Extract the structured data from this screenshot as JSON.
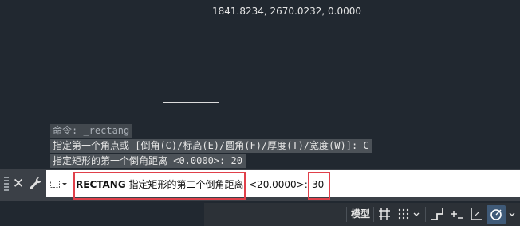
{
  "command_history": [
    {
      "text": "命令: _rectang"
    },
    {
      "text": "指定第一个角点或 [倒角(C)/标高(E)/圆角(F)/厚度(T)/宽度(W)]: C"
    },
    {
      "text": "指定矩形的第一个倒角距离 <0.0000>: 20"
    }
  ],
  "command_line": {
    "command_name": "RECTANG",
    "prompt": "指定矩形的第二个倒角距离",
    "default_value": "<20.0000>:",
    "typed_value": "30"
  },
  "status_bar": {
    "coordinates": "1841.8234, 2670.0232, 0.0000",
    "model_label": "模型"
  },
  "colors": {
    "canvas_bg": "#212830",
    "highlight_red": "#e0404a",
    "active_icon": "#3f5a78"
  }
}
